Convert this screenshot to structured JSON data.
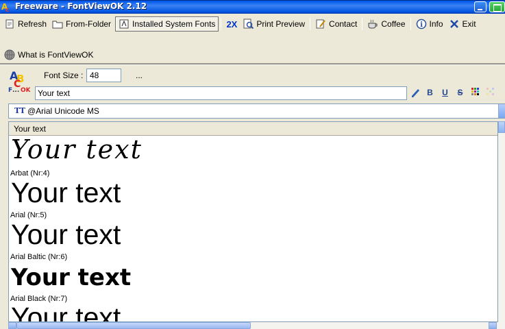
{
  "window": {
    "title": "Freeware - FontViewOK 2.12"
  },
  "toolbar": {
    "row1": [
      {
        "label": "Refresh",
        "icon": "refresh-icon"
      },
      {
        "label": "From-Folder",
        "icon": "folder-icon"
      },
      {
        "label": "Installed System Fonts",
        "icon": "fonts-icon",
        "active": true
      },
      {
        "label": "2X",
        "icon": ""
      },
      {
        "label": "Print Preview",
        "icon": "print-preview-icon"
      },
      {
        "label": "Contact",
        "icon": "contact-icon"
      },
      {
        "label": "Coffee",
        "icon": "coffee-icon"
      },
      {
        "label": "Info",
        "icon": "info-icon"
      },
      {
        "label": "Exit",
        "icon": "exit-icon"
      }
    ],
    "row2": [
      {
        "label": "What is FontViewOK",
        "icon": "globe-icon"
      }
    ]
  },
  "options": {
    "font_size_label": "Font Size :",
    "font_size_value": "48",
    "ellipsis": "...",
    "sample_text": "Your text"
  },
  "font_select": {
    "value": "@Arial Unicode MS"
  },
  "preview": {
    "header": "Your text",
    "items": [
      {
        "sample": "Your text",
        "caption": "Arbat (Nr:4)"
      },
      {
        "sample": "Your text",
        "caption": "Arial (Nr:5)"
      },
      {
        "sample": "Your text",
        "caption": "Arial Baltic (Nr:6)"
      },
      {
        "sample": "Your text",
        "caption": "Arial Black (Nr:7)"
      },
      {
        "sample": "Your text",
        "caption": ""
      }
    ]
  },
  "colors": {
    "titlebar": "#0058ee",
    "window_bg": "#ece9d8",
    "link_blue": "#0033cc"
  }
}
